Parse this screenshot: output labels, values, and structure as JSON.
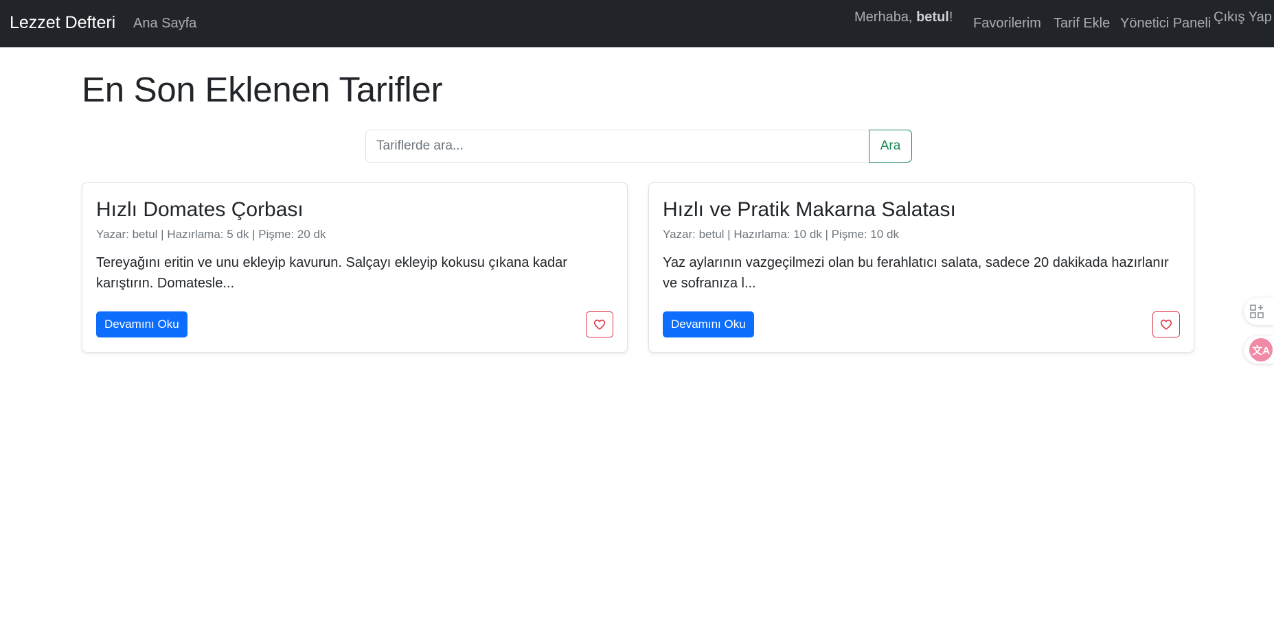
{
  "navbar": {
    "brand": "Lezzet Defteri",
    "home_link": "Ana Sayfa",
    "greeting_prefix": "Merhaba, ",
    "username": "betul",
    "greeting_suffix": "!",
    "favorites_link": "Favorilerim",
    "add_recipe_link": "Tarif Ekle",
    "admin_link": "Yönetici Paneli",
    "logout_link": "Çıkış Yap"
  },
  "main": {
    "title": "En Son Eklenen Tarifler",
    "search": {
      "placeholder": "Tariflerde ara...",
      "button_label": "Ara"
    },
    "recipes": [
      {
        "title": "Hızlı Domates Çorbası",
        "meta": "Yazar: betul | Hazırlama: 5 dk | Pişme: 20 dk",
        "excerpt": "Tereyağını eritin ve unu ekleyip kavurun. Salçayı ekleyip kokusu çıkana kadar karıştırın. Domatesle...",
        "read_more": "Devamını Oku"
      },
      {
        "title": "Hızlı ve Pratik Makarna Salatası",
        "meta": "Yazar: betul | Hazırlama: 10 dk | Pişme: 10 dk",
        "excerpt": "Yaz aylarının vazgeçilmezi olan bu ferahlatıcı salata, sadece 20 dakikada hazırlanır ve sofranıza l...",
        "read_more": "Devamını Oku"
      }
    ]
  },
  "side_widgets": {
    "apps_icon": "apps-add-icon",
    "translate_icon": "translate-icon",
    "translate_glyph": "文A"
  },
  "colors": {
    "navbar_bg": "#212529",
    "primary": "#0d6efd",
    "success": "#198754",
    "danger": "#dc3545"
  }
}
